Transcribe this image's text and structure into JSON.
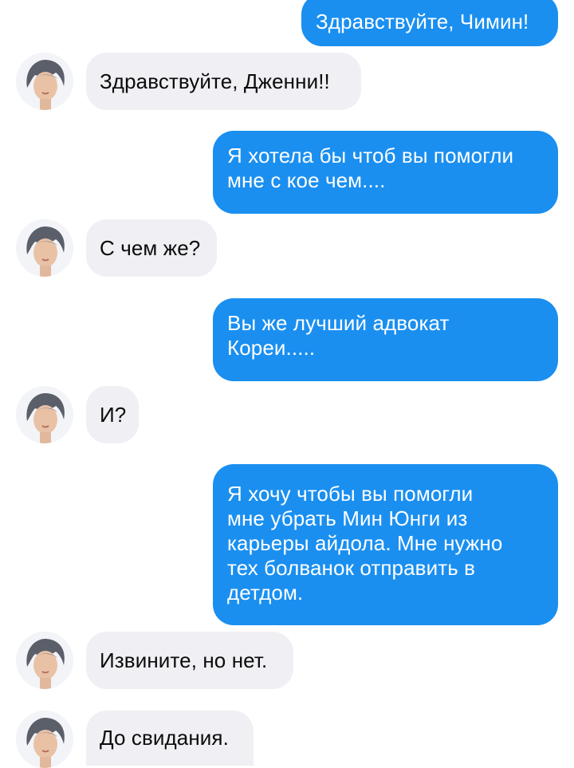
{
  "contact": {
    "avatar_icon": "contact-photo-icon"
  },
  "messages": [
    {
      "from": "me",
      "text": "Здравствуйте, Чимин!"
    },
    {
      "from": "contact",
      "text": "Здравствуйте, Дженни!!"
    },
    {
      "from": "me",
      "text": "Я хотела бы чтоб вы помогли\nмне с кое чем...."
    },
    {
      "from": "contact",
      "text": "С чем же?"
    },
    {
      "from": "me",
      "text": "Вы же лучший адвокат\nКореи....."
    },
    {
      "from": "contact",
      "text": "И?"
    },
    {
      "from": "me",
      "text": "Я хочу чтобы вы помогли\nмне убрать Мин Юнги из\nкарьеры айдола. Мне нужно\nтех болванок отправить в\nдетдом."
    },
    {
      "from": "contact",
      "text": "Извините, но нет."
    },
    {
      "from": "contact",
      "text": "До свидания."
    }
  ],
  "colors": {
    "sent_bubble": "#1a8ff0",
    "received_bubble": "#efeff4"
  }
}
